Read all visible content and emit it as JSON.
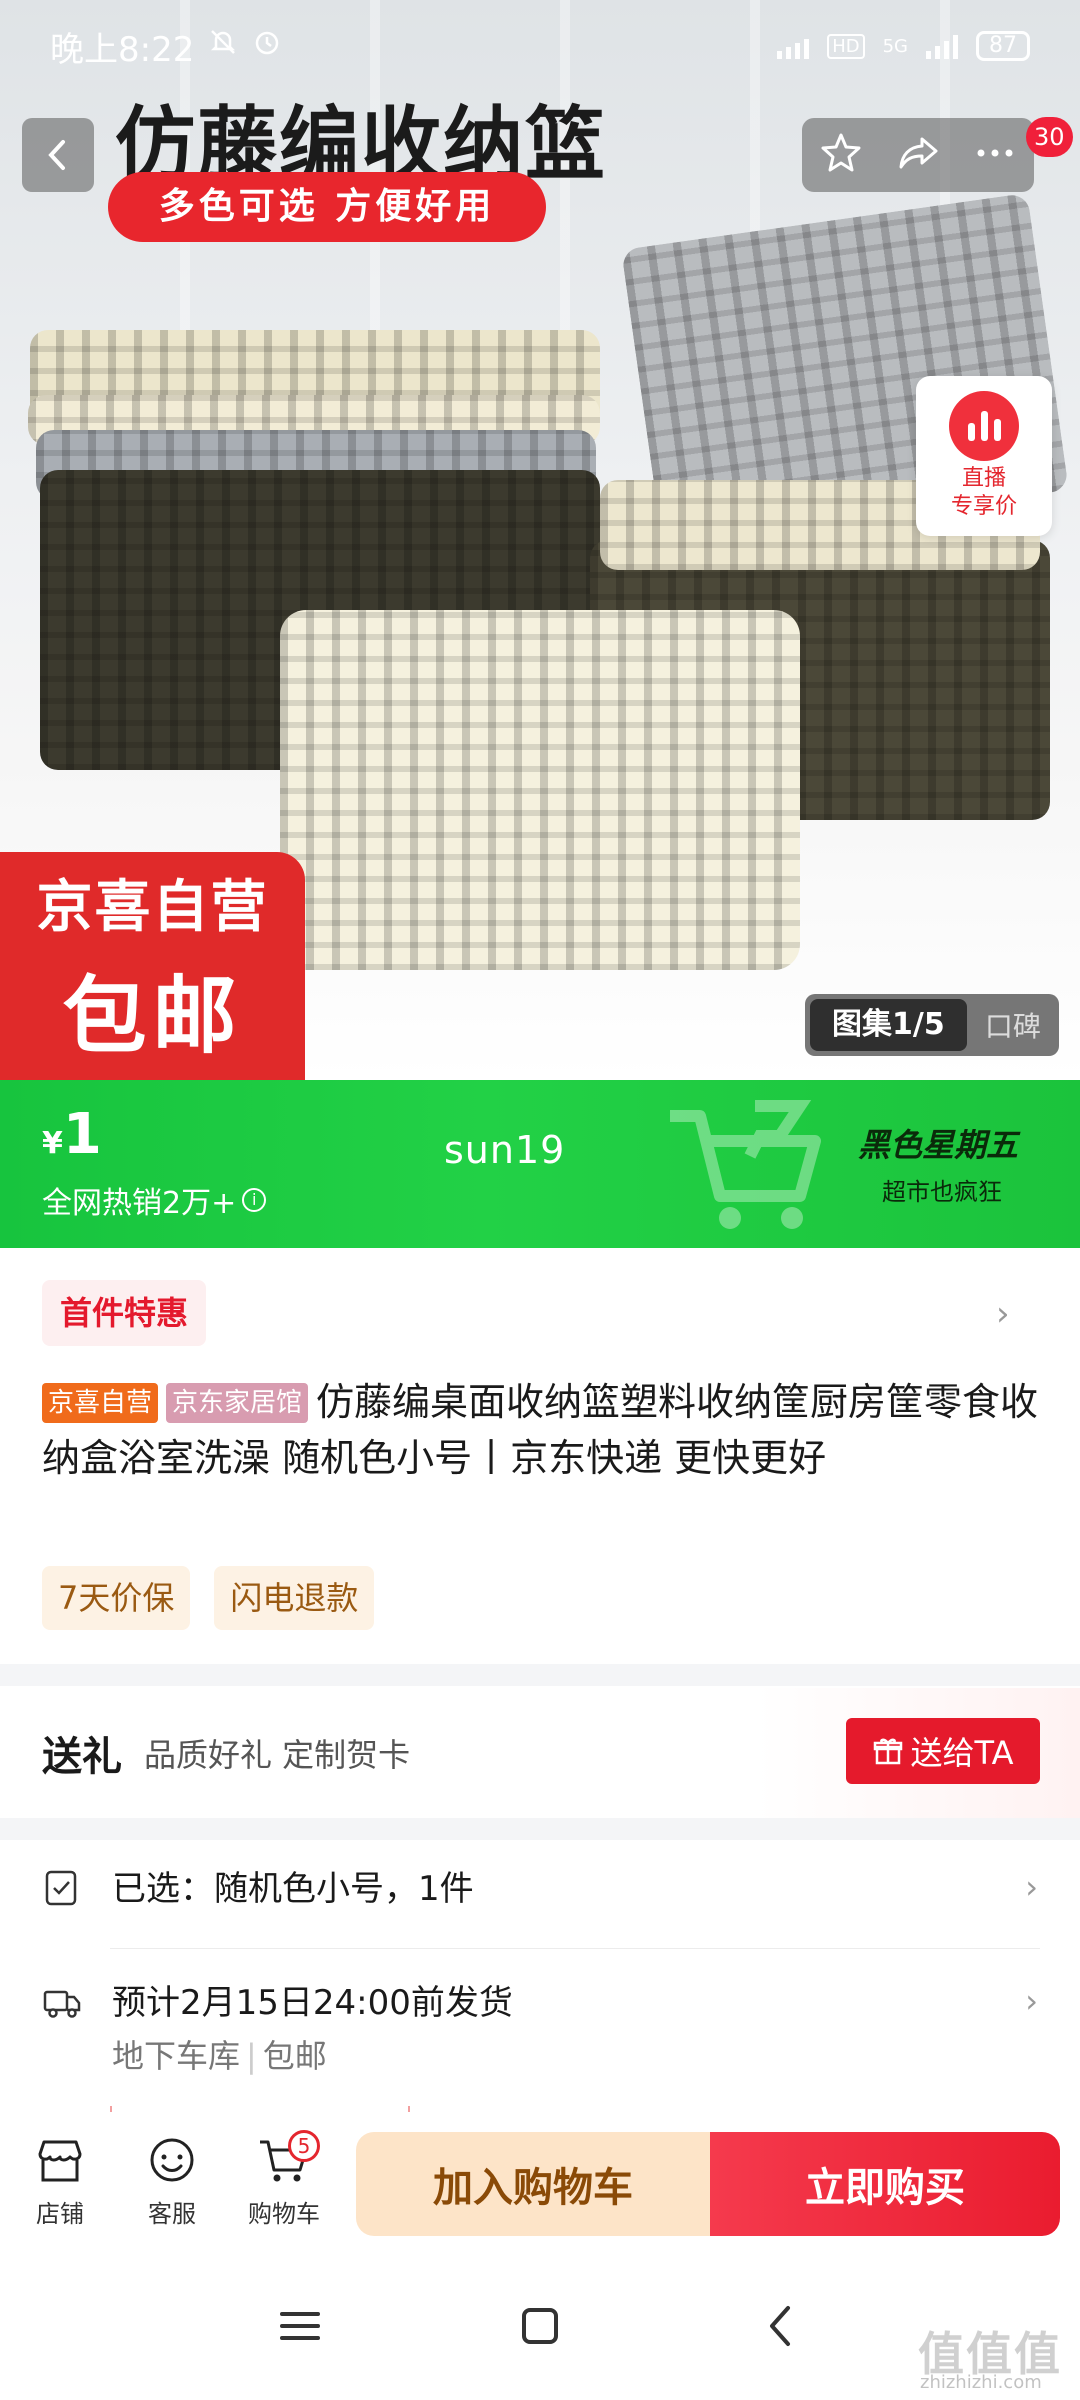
{
  "status_bar": {
    "time": "晚上8:22",
    "battery": "87",
    "network": "5G"
  },
  "hero": {
    "title": "仿藤编收纳篮",
    "subtitle": "多色可选 方便好用",
    "stamp_line1": "京喜自营",
    "stamp_line2": "包邮",
    "live_line1": "直播",
    "live_line2": "专享价",
    "gallery_label": "图集1/5",
    "review_label": "口碑",
    "notification_count": "30"
  },
  "promo": {
    "currency": "¥",
    "price": "1",
    "sales": "全网热销2万+",
    "code": "sun19",
    "event": "黑色星期五",
    "event_tag": "超市也疯狂"
  },
  "product": {
    "first_deal": "首件特惠",
    "tag_jx": "京喜自营",
    "tag_home": "京东家居馆",
    "title": "仿藤编桌面收纳篮塑料收纳筐厨房筐零食收纳盒浴室洗澡 随机色小号丨京东快递 更快更好",
    "services": [
      "7天价保",
      "闪电退款"
    ]
  },
  "gift": {
    "title": "送礼",
    "desc": "品质好礼 定制贺卡",
    "button": "送给TA"
  },
  "spec": {
    "selected": "已选：随机色小号，1件",
    "delivery": "预计2月15日24:00前发货",
    "delivery_sub1": "地下车库",
    "delivery_sub2": "包邮"
  },
  "bottom_bar": {
    "store": "店铺",
    "service": "客服",
    "cart": "购物车",
    "cart_count": "5",
    "add_to_cart": "加入购物车",
    "buy_now": "立即购买"
  },
  "watermark": {
    "main": "值值值",
    "sub": "zhizhizhi.com"
  },
  "colors": {
    "accent_red": "#e51a2c",
    "promo_green": "#1ec33f",
    "service_tag_bg": "#fdf2e4"
  }
}
